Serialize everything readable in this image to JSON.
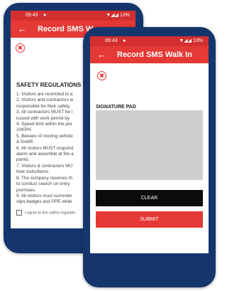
{
  "back_screen": {
    "status": {
      "time": "09:43",
      "notification_icon": "chat-bubble-icon",
      "system": "▼◢◢ 13%"
    },
    "appbar": {
      "back_icon": "←",
      "title": "Record SMS W"
    },
    "close_icon": "✖",
    "regulations_title": "SAFETY REGULATIONS",
    "regulations": [
      "1. Visitors are restricted to a",
      "2. Visitors and contractors w",
      "responsible for their safety.",
      "3. All contractors MUST be i",
      "issued with work permit by",
      "4. Speed limit within the pre",
      "10KPH.",
      "5. Beware of moving vehicle",
      "& forklift.",
      "6. All visitors MUST respond",
      "alarm and assemble at fire a",
      "points.",
      "7. Visitors & contractors MU",
      "their tools/items.",
      "8. The company reserves th",
      "to conduct search on entry",
      "premises.",
      "9. All visitors must surrende",
      "slips,badges and PPE while"
    ],
    "agree_label": "I agree to the safety regulatio"
  },
  "front_screen": {
    "status": {
      "time": "09:43",
      "notification_icon": "chat-bubble-icon",
      "system": "▼◢◢ 13%"
    },
    "appbar": {
      "back_icon": "←",
      "title": "Record SMS Walk In"
    },
    "close_icon": "✖",
    "signature_label": "SIGNATURE PAD",
    "clear_label": "CLEAR",
    "submit_label": "SUBMIT"
  },
  "colors": {
    "appbar": "#e53935",
    "statusbar": "#d32f2f",
    "phone_frame": "#14366d",
    "clear_button": "#0b0b0b",
    "signature_pad": "#cfcfcf"
  }
}
